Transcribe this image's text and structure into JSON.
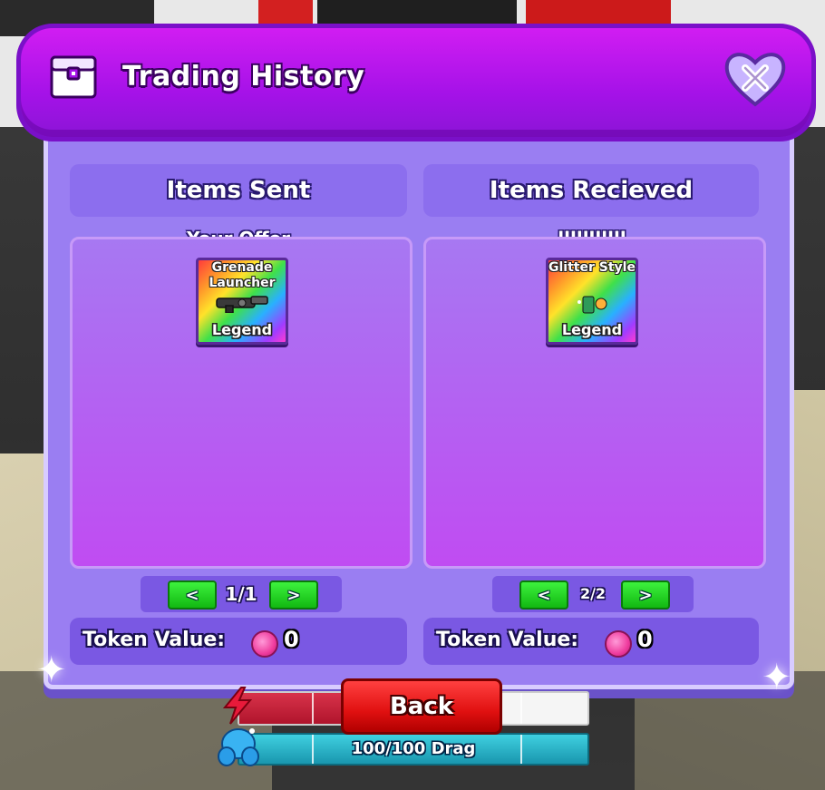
{
  "window": {
    "title": "Trading History",
    "close_label": "X"
  },
  "sent": {
    "header": "Items Sent",
    "label": "Your Offer",
    "items": [
      {
        "name": "Grenade Launcher",
        "rarity": "Legend"
      }
    ],
    "pager": {
      "prev": "<",
      "page": "1/1",
      "next": ">"
    },
    "token_label": "Token Value:",
    "token_value": "0"
  },
  "received": {
    "header": "Items Recieved",
    "label": "lllllllllll",
    "items": [
      {
        "name": "Glitter Style",
        "rarity": "Legend"
      }
    ],
    "pager": {
      "prev": "<",
      "page": "2/2",
      "next": ">"
    },
    "token_label": "Token Value:",
    "token_value": "0"
  },
  "hud": {
    "back_label": "Back",
    "drag_text": "100/100 Drag",
    "health_fraction": 0.3
  },
  "colors": {
    "header_purple": "#a512e8",
    "panel_purple": "#9a7ef2",
    "pager_green": "#12b812",
    "back_red": "#e01010",
    "coin_pink": "#ef3c9e"
  }
}
